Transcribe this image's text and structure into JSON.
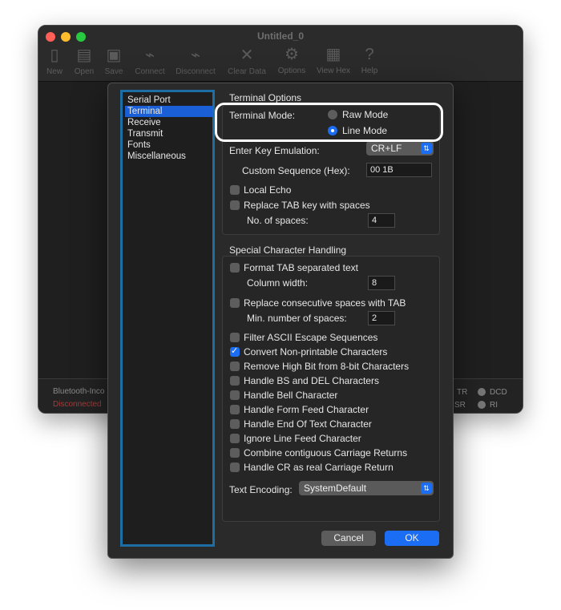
{
  "window": {
    "title": "Untitled_0",
    "toolbar": [
      {
        "label": "New",
        "icon": "new-file-icon"
      },
      {
        "label": "Open",
        "icon": "open-folder-icon"
      },
      {
        "label": "Save",
        "icon": "save-disk-icon"
      },
      {
        "label": "Connect",
        "icon": "connect-plug-icon"
      },
      {
        "label": "Disconnect",
        "icon": "disconnect-plug-icon"
      },
      {
        "label": "Clear Data",
        "icon": "clear-x-icon"
      },
      {
        "label": "Options",
        "icon": "options-gears-icon"
      },
      {
        "label": "View Hex",
        "icon": "hex-icon"
      },
      {
        "label": "Help",
        "icon": "help-question-icon"
      }
    ],
    "status": {
      "device": "Bluetooth-Inco",
      "connection": "Disconnected",
      "signals": [
        "TR",
        "DCD",
        "SR",
        "RI"
      ]
    }
  },
  "dialog": {
    "sidebar": [
      "Serial Port",
      "Terminal",
      "Receive",
      "Transmit",
      "Fonts",
      "Miscellaneous"
    ],
    "selected_sidebar": "Terminal",
    "terminal_options": {
      "title": "Terminal Options",
      "mode_label": "Terminal Mode:",
      "raw_mode": "Raw Mode",
      "line_mode": "Line Mode",
      "selected_mode": "Line Mode",
      "enter_key_label": "Enter Key Emulation:",
      "enter_key_value": "CR+LF",
      "custom_seq_label": "Custom Sequence (Hex):",
      "custom_seq_value": "00 1B",
      "local_echo": "Local Echo",
      "replace_tab": "Replace TAB key with spaces",
      "no_spaces_label": "No. of spaces:",
      "no_spaces_value": "4"
    },
    "special": {
      "title": "Special Character Handling",
      "format_tab": "Format TAB separated text",
      "column_width_label": "Column width:",
      "column_width_value": "8",
      "replace_consec": "Replace consecutive spaces with TAB",
      "min_spaces_label": "Min. number of spaces:",
      "min_spaces_value": "2",
      "options": [
        {
          "label": "Filter ASCII Escape Sequences",
          "checked": false
        },
        {
          "label": "Convert Non-printable Characters",
          "checked": true
        },
        {
          "label": "Remove High Bit from 8-bit Characters",
          "checked": false
        },
        {
          "label": "Handle BS and DEL Characters",
          "checked": false
        },
        {
          "label": "Handle Bell Character",
          "checked": false
        },
        {
          "label": "Handle Form Feed Character",
          "checked": false
        },
        {
          "label": "Handle End Of Text Character",
          "checked": false
        },
        {
          "label": "Ignore Line Feed Character",
          "checked": false
        },
        {
          "label": "Combine contiguous Carriage Returns",
          "checked": false
        },
        {
          "label": "Handle CR as real Carriage Return",
          "checked": false
        }
      ],
      "encoding_label": "Text Encoding:",
      "encoding_value": "SystemDefault"
    },
    "buttons": {
      "cancel": "Cancel",
      "ok": "OK"
    }
  },
  "colors": {
    "accent": "#1b6ef3",
    "sidebar_border": "#1c6ea4",
    "highlight": "#ffffff"
  }
}
